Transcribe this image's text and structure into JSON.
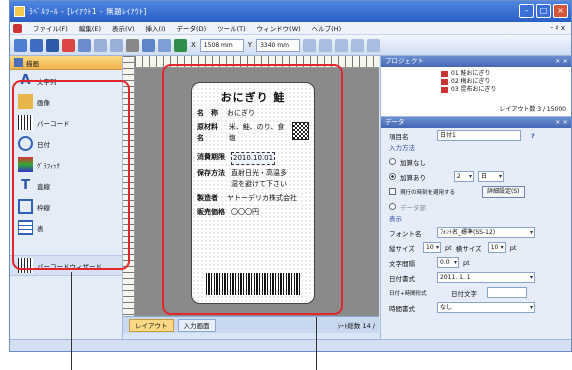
{
  "window": {
    "title": "ﾗﾍﾞﾙﾂｰﾙ - [ﾚｲｱｳﾄ1 - 無題ﾚｲｱｳﾄ]"
  },
  "menu": {
    "items": [
      "ファイル(F)",
      "編集(E)",
      "表示(V)",
      "挿入(I)",
      "データ(D)",
      "ツール(T)",
      "ウィンドウ(W)",
      "ヘルプ(H)"
    ],
    "controls": "- ♯ x"
  },
  "toolbar": {
    "x_label": "X",
    "x_value": "1508 mm",
    "y_label": "Y",
    "y_value": "3340 mm"
  },
  "sidebar": {
    "header": "描画",
    "tools": [
      {
        "label": "文字列",
        "icon": "text-icon"
      },
      {
        "label": "画像",
        "icon": "image-icon"
      },
      {
        "label": "バーコード",
        "icon": "barcode-icon"
      },
      {
        "label": "日付",
        "icon": "date-icon"
      },
      {
        "label": "ｸﾞﾗﾌｨｯｸ",
        "icon": "graphic-icon"
      },
      {
        "label": "直線",
        "icon": "line-icon"
      },
      {
        "label": "枠線",
        "icon": "frame-icon"
      },
      {
        "label": "表",
        "icon": "table-icon"
      }
    ],
    "wizard": "バーコードウィザード"
  },
  "label": {
    "title": "おにぎり 鮭",
    "rows": [
      {
        "k": "名　称",
        "v": "おにぎり"
      },
      {
        "k": "原材料名",
        "v": "米、鮭、のり、食塩"
      },
      {
        "k": "消費期限",
        "v": "2010.10.01"
      },
      {
        "k": "保存方法",
        "v": "直射日光・高温多湿を避けて下さい"
      },
      {
        "k": "製造者",
        "v": "ヤトーデリカ株式会社"
      },
      {
        "k": "販売価格",
        "v": "〇〇〇円"
      }
    ]
  },
  "bottom": {
    "tabs": [
      "レイアウト",
      "入力画面"
    ],
    "page_count": "ｼｰﾄ総数 14 /"
  },
  "right": {
    "project_header": "プロジェクト",
    "project_items": [
      "01 鮭おにぎり",
      "02 梅おにぎり",
      "03 昆布おにぎり"
    ],
    "project_status": "レイアウト数 3 / 15000",
    "data_header": "データ",
    "item_name_label": "項目名",
    "item_name_value": "日付1",
    "input_section": "入力方法",
    "radio_none": "加算なし",
    "radio_add": "加算あり",
    "add_value": "2",
    "add_unit": "日",
    "check_auto": "現行の時刻を適用する",
    "btn_detail": "詳細設定(S)",
    "field_label": "データ部",
    "display_section": "表示",
    "font_label": "フォント名",
    "font_value": "ﾌｫﾝﾄ名_標準(SS-12)",
    "size_label": "縦サイズ",
    "size_value": "10",
    "size_unit": "pt",
    "wsize_label": "横サイズ",
    "wsize_value": "10",
    "wsize_unit": "pt",
    "spacing_label": "文字間隔",
    "spacing_value": "0.0",
    "spacing_unit": "pt",
    "datefmt_label": "日付書式",
    "datefmt_value": "2011. 1. 1",
    "datetime_label": "日付+時間形式",
    "datetime_value": "日付文字",
    "time_label": "時間書式",
    "time_value": "なし"
  }
}
